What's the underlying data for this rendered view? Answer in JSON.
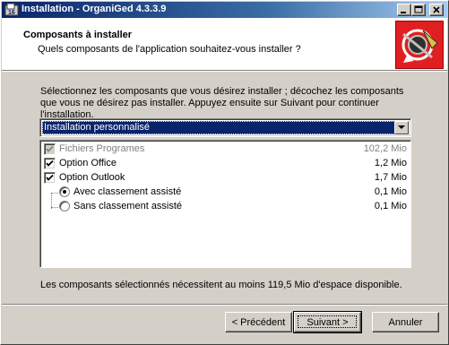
{
  "window": {
    "title": "Installation - OrganiGed 4.3.3.9"
  },
  "header": {
    "title": "Composants à installer",
    "subtitle": "Quels composants de l'application souhaitez-vous installer ?"
  },
  "description": "Sélectionnez les composants que vous désirez installer ; décochez les composants que vous ne désirez pas installer. Appuyez ensuite sur Suivant pour continuer l'installation.",
  "install_type": {
    "selected": "Installation personnalisé"
  },
  "components": [
    {
      "label": "Fichiers Programes",
      "size": "102,2 Mio",
      "type": "checkbox",
      "checked": true,
      "disabled": true
    },
    {
      "label": "Option Office",
      "size": "1,2 Mio",
      "type": "checkbox",
      "checked": true,
      "disabled": false
    },
    {
      "label": "Option Outlook",
      "size": "1,7 Mio",
      "type": "checkbox",
      "checked": true,
      "disabled": false
    },
    {
      "label": "Avec classement assisté",
      "size": "0,1 Mio",
      "type": "radio",
      "checked": true,
      "disabled": false
    },
    {
      "label": "Sans classement assisté",
      "size": "0,1 Mio",
      "type": "radio",
      "checked": false,
      "disabled": false
    }
  ],
  "space_required": "Les composants sélectionnés nécessitent au moins 119,5 Mio d'espace disponible.",
  "buttons": {
    "back": "< Précédent",
    "next": "Suivant >",
    "cancel": "Annuler"
  },
  "icons": {
    "app": "installer-icon",
    "minimize": "minimize-icon",
    "maximize": "maximize-icon",
    "close": "close-icon",
    "logo": "organiged-logo"
  },
  "colors": {
    "titlebar_start": "#0a246a",
    "titlebar_end": "#a6caf0",
    "selection": "#0a246a",
    "logo_red": "#e02020"
  }
}
